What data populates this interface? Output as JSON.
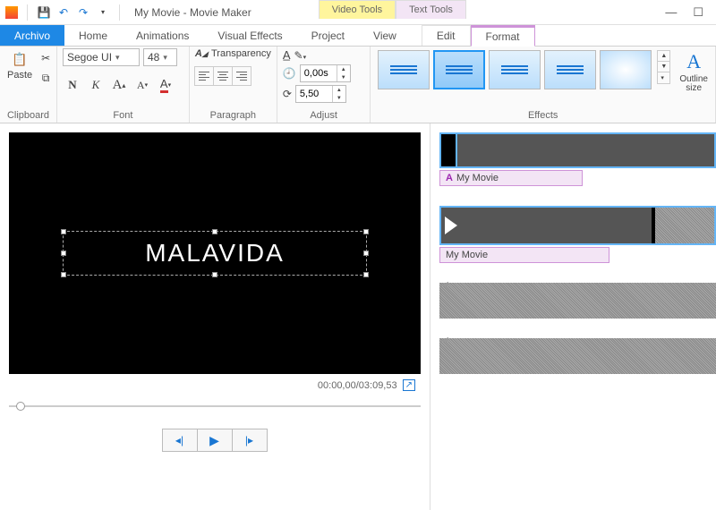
{
  "window": {
    "title": "My Movie - Movie Maker"
  },
  "context_tabs": {
    "video": "Video Tools",
    "text": "Text Tools"
  },
  "tabs": {
    "file": "Archivo",
    "home": "Home",
    "animations": "Animations",
    "visual_effects": "Visual Effects",
    "project": "Project",
    "view": "View",
    "edit": "Edit",
    "format": "Format"
  },
  "ribbon": {
    "clipboard": {
      "label": "Clipboard",
      "paste": "Paste"
    },
    "font": {
      "label": "Font",
      "family": "Segoe UI",
      "size": "48",
      "bold": "N",
      "italic": "K",
      "bigA": "A",
      "smallA": "A"
    },
    "paragraph": {
      "label": "Paragraph",
      "transparency": "Transparency"
    },
    "adjust": {
      "label": "Adjust",
      "start_time": "0,00s",
      "duration": "5,50"
    },
    "effects": {
      "label": "Effects"
    },
    "outline": {
      "label": "Outline size",
      "short": "Ou"
    }
  },
  "preview": {
    "text_overlay": "MALAVIDA",
    "timecode": "00:00,00/03:09,53"
  },
  "timeline": {
    "clip1_caption": "My Movie",
    "clip2_caption": "My Movie"
  }
}
